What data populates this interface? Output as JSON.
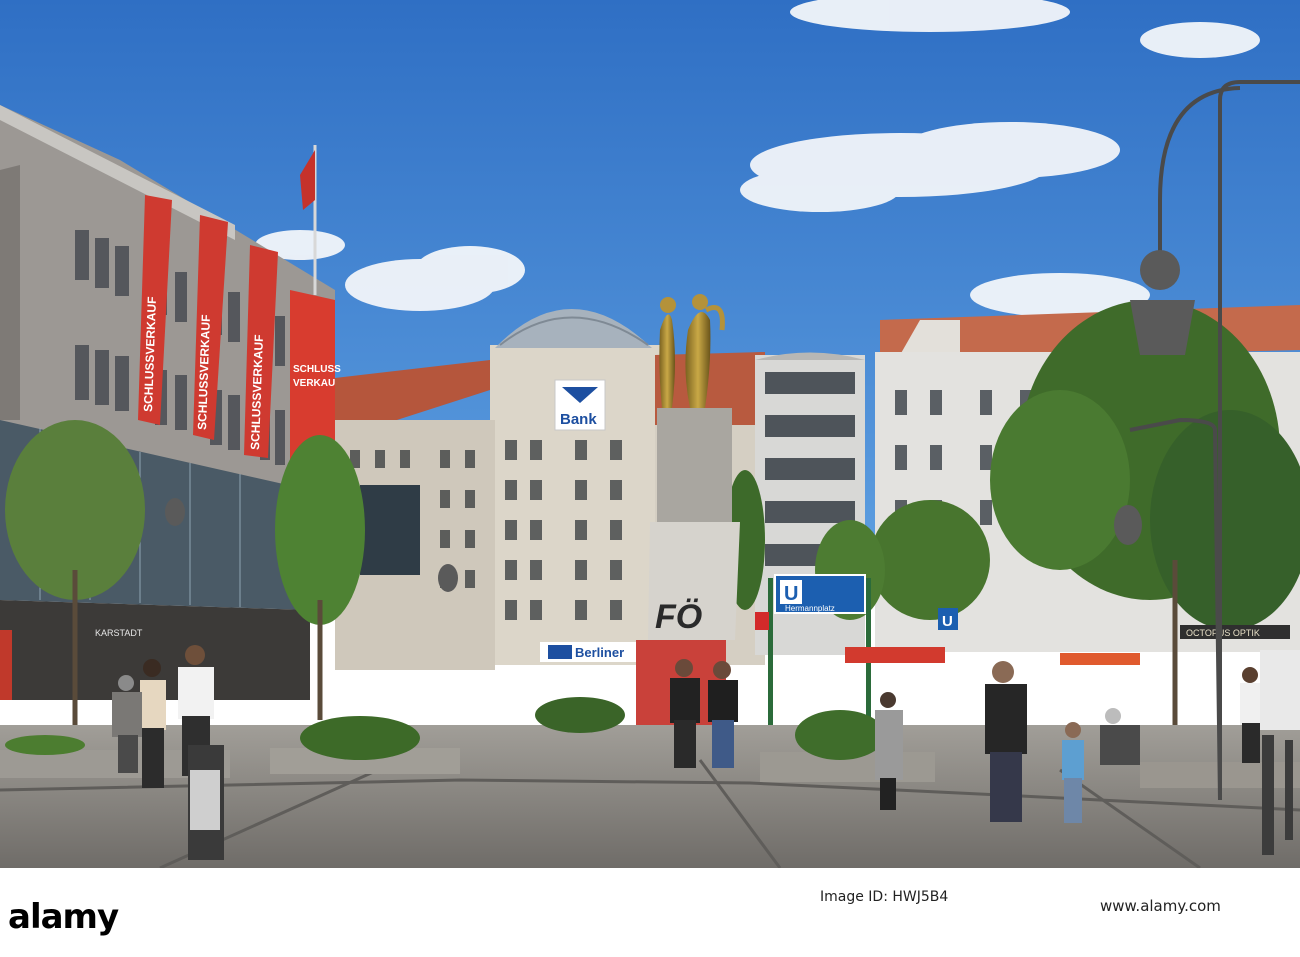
{
  "signs": {
    "banner_1": "SCHLUSSVERKAUF",
    "banner_2": "SCHLUSSVERKAUF",
    "banner_3": "SCHLUSSVERKAUF",
    "big_banner_line1": "SCHLUSS",
    "big_banner_line2": "VERKAUF",
    "store_name": "KARSTADT",
    "bank_sign": "Bank",
    "berliner_sign": "Berliner",
    "ubahn_letter": "U",
    "station_name": "Hermannplatz",
    "small_u": "U",
    "optik_sign": "OCTOPUS OPTIK",
    "graffiti": "FÖ"
  },
  "watermark": {
    "logo": "alamy",
    "image_id_line1": "Image ID: HWJ5B4",
    "image_id_line2": "www.alamy.com"
  },
  "colors": {
    "sky": "#3f7fd0",
    "banner_red": "#d4372f",
    "ubahn_blue": "#1c5fb0",
    "tree_green": "#3f6b2a",
    "pavement": "#8a8783"
  }
}
